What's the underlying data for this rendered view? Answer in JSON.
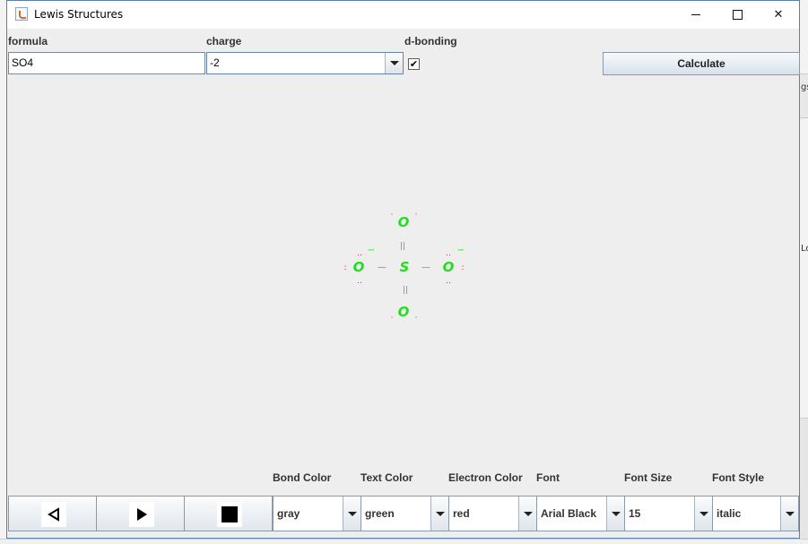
{
  "window": {
    "title": "Lewis Structures",
    "minimize_label": "—",
    "maximize_label": "☐",
    "close_label": "✕"
  },
  "form": {
    "formula_label": "formula",
    "formula_value": "SO4",
    "charge_label": "charge",
    "charge_value": "-2",
    "dbonding_label": "d-bonding",
    "dbonding_checked": true,
    "dbonding_mark": "✔",
    "calculate_label": "Calculate"
  },
  "molecule": {
    "center_atom": "S",
    "atoms": [
      "O",
      "O",
      "O",
      "O"
    ],
    "bond_color": "gray",
    "text_color": "#22dd22",
    "electron_color": "#dd2222",
    "single_bond": "—",
    "double_bond": "||",
    "electron_pair": "..",
    "lone_pair": ":",
    "single_electron": "·",
    "charge_mark": "−"
  },
  "bottom": {
    "labels": {
      "bond_color": "Bond Color",
      "text_color": "Text Color",
      "electron_color": "Electron Color",
      "font": "Font",
      "font_size": "Font Size",
      "font_style": "Font Style"
    },
    "values": {
      "bond_color": "gray",
      "text_color": "green",
      "electron_color": "red",
      "font": "Arial Black",
      "font_size": "15",
      "font_style": "italic"
    },
    "controls": [
      "back-icon",
      "play-icon",
      "stop-icon"
    ]
  },
  "background": {
    "right_fragment_top": "gs",
    "right_fragment_mid": "Lo"
  }
}
